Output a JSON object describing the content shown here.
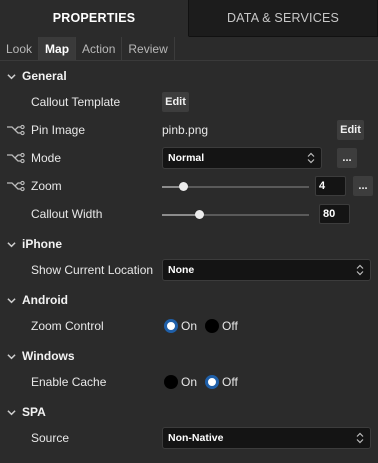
{
  "tabs": {
    "properties": "PROPERTIES",
    "data_services": "DATA & SERVICES"
  },
  "subtabs": [
    "Look",
    "Map",
    "Action",
    "Review"
  ],
  "active_subtab": "Map",
  "sections": {
    "general": "General",
    "iphone": "iPhone",
    "android": "Android",
    "windows": "Windows",
    "spa": "SPA"
  },
  "general": {
    "callout_template": {
      "label": "Callout Template",
      "button": "Edit"
    },
    "pin_image": {
      "label": "Pin Image",
      "value": "pinb.png",
      "button": "Edit"
    },
    "mode": {
      "label": "Mode",
      "value": "Normal",
      "more_button": "..."
    },
    "zoom": {
      "label": "Zoom",
      "value": "4",
      "more_button": "..."
    },
    "callout_width": {
      "label": "Callout Width",
      "value": "80"
    }
  },
  "iphone": {
    "show_current_location": {
      "label": "Show Current Location",
      "value": "None"
    }
  },
  "android": {
    "zoom_control": {
      "label": "Zoom Control",
      "option_on": "On",
      "option_off": "Off",
      "selected": "On"
    }
  },
  "windows": {
    "enable_cache": {
      "label": "Enable Cache",
      "option_on": "On",
      "option_off": "Off",
      "selected": "Off"
    }
  },
  "spa": {
    "source": {
      "label": "Source",
      "value": "Non-Native"
    }
  },
  "colors": {
    "background": "#2b2b2b",
    "radio_accent": "#1f5fa8"
  }
}
